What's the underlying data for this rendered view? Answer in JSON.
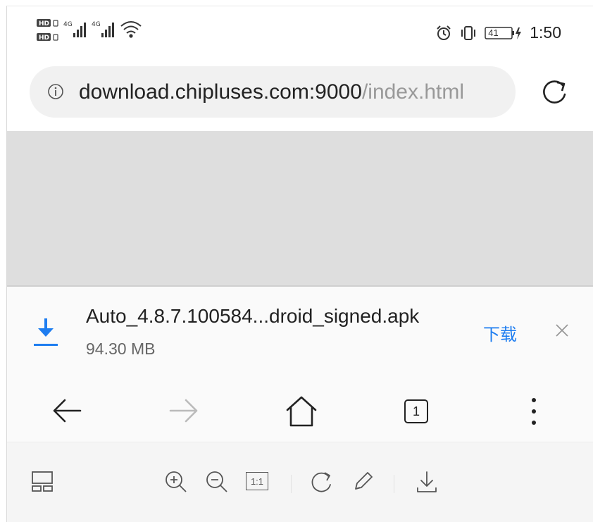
{
  "status_bar": {
    "network_labels": [
      "4G",
      "4G"
    ],
    "battery_level": "41",
    "time": "1:50"
  },
  "address_bar": {
    "host": "download.chipluses.com:9000",
    "path": "/index.html"
  },
  "download": {
    "filename": "Auto_4.8.7.100584...droid_signed.apk",
    "size": "94.30 MB",
    "action_label": "下载",
    "accent_color": "#1e7df0"
  },
  "navigation": {
    "tab_count": "1",
    "icons": [
      "back-arrow-icon",
      "forward-arrow-icon",
      "home-icon",
      "tabs-icon",
      "more-vertical-icon"
    ]
  },
  "toolbar": {
    "zoom_reset_label": "1:1",
    "icons": [
      "layout-icon",
      "zoom-in-icon",
      "zoom-out-icon",
      "zoom-reset-icon",
      "rotate-icon",
      "edit-pen-icon",
      "download-icon"
    ]
  }
}
